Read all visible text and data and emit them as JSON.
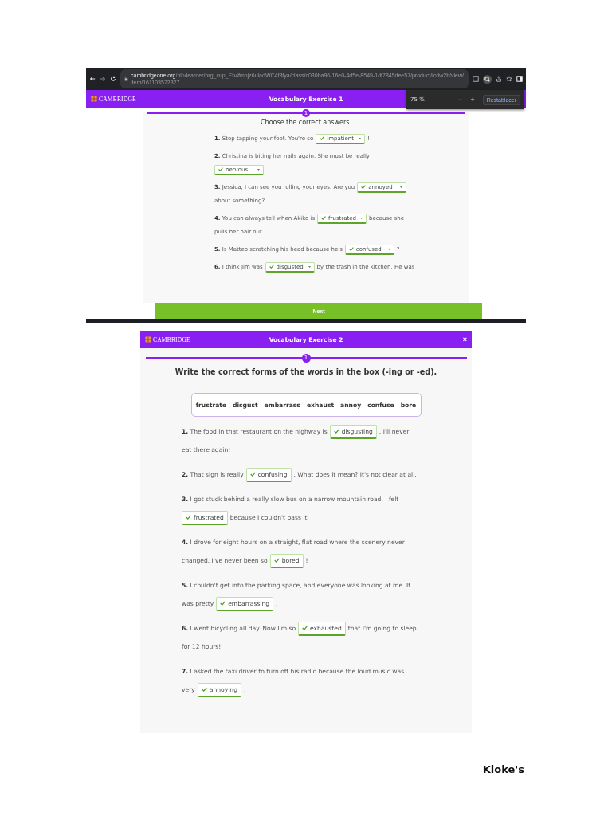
{
  "screenshots": [
    {
      "browser": {
        "url": "**cambridgeone.org**/nlp/learner/org_cup_Eb4fmnjz6uladWC4f3fya/class/c030ba96-16e0-4d5e-8549-1df7845dee57/product/icdw2b/view/item/161103572327..."
      },
      "zoom_popup": {
        "level": "75 %",
        "minus": "−",
        "plus": "+",
        "reset": "Restablecer"
      },
      "header": {
        "logo": "CAMBRIDGE",
        "title": "Vocabulary Exercise 1"
      },
      "progress": {
        "step": "1"
      },
      "instruction": "Choose the correct answers.",
      "items": [
        {
          "parts": [
            {
              "kind": "text",
              "text": "**1.** Stop tapping your foot. You're so"
            },
            {
              "kind": "answer",
              "text": "impatient",
              "correct": true
            },
            {
              "kind": "text",
              "text": "!"
            }
          ]
        },
        {
          "parts": [
            {
              "kind": "text",
              "text": "**2.** Christina is biting her nails again. She must be really"
            },
            {
              "kind": "answer",
              "text": "nervous",
              "correct": true
            },
            {
              "kind": "text",
              "text": "."
            }
          ]
        },
        {
          "parts": [
            {
              "kind": "text",
              "text": "**3.** Jessica, I can see you rolling your eyes. Are you"
            },
            {
              "kind": "answer",
              "text": "annoyed",
              "correct": true
            },
            {
              "kind": "text",
              "text": "about something?"
            }
          ]
        },
        {
          "parts": [
            {
              "kind": "text",
              "text": "**4.** You can always tell when Akiko is"
            },
            {
              "kind": "answer",
              "text": "frustrated",
              "correct": true
            },
            {
              "kind": "text",
              "text": "because she pulls her hair out."
            }
          ]
        },
        {
          "parts": [
            {
              "kind": "text",
              "text": "**5.** Is Matteo scratching his head because he's"
            },
            {
              "kind": "answer",
              "text": "confused",
              "correct": true
            },
            {
              "kind": "text",
              "text": "?"
            }
          ]
        },
        {
          "parts": [
            {
              "kind": "text",
              "text": "**6.** I think Jim was"
            },
            {
              "kind": "answer",
              "text": "disgusted",
              "correct": true
            },
            {
              "kind": "text",
              "text": "by the trash in the kitchen. He was"
            }
          ]
        }
      ],
      "next_button": "Next"
    },
    {
      "header": {
        "logo": "CAMBRIDGE",
        "title": "Vocabulary Exercise 2",
        "close": "×"
      },
      "progress": {
        "step": "1"
      },
      "instruction": "Write the correct forms of the words in the box (-ing or -ed).",
      "word_box": [
        "frustrate",
        "disgust",
        "embarrass",
        "exhaust",
        "annoy",
        "confuse",
        "bore"
      ],
      "items": [
        {
          "parts": [
            {
              "kind": "text",
              "text": "**1.** The food in that restaurant on the highway is"
            },
            {
              "kind": "answer",
              "text": "disgusting",
              "correct": true
            },
            {
              "kind": "text",
              "text": ". I'll never eat there again!"
            }
          ]
        },
        {
          "parts": [
            {
              "kind": "text",
              "text": "**2.** That sign is really"
            },
            {
              "kind": "answer",
              "text": "confusing",
              "correct": true
            },
            {
              "kind": "text",
              "text": ". What does it mean? It's not clear at all."
            }
          ]
        },
        {
          "parts": [
            {
              "kind": "text",
              "text": "**3.** I got stuck behind a really slow bus on a narrow mountain road. I felt"
            },
            {
              "kind": "answer",
              "text": "frustrated",
              "correct": true
            },
            {
              "kind": "text",
              "text": "because I couldn't pass it."
            }
          ]
        },
        {
          "parts": [
            {
              "kind": "text",
              "text": "**4.** I drove for eight hours on a straight, flat road where the scenery never changed. I've never been so"
            },
            {
              "kind": "answer",
              "text": "bored",
              "correct": true
            },
            {
              "kind": "text",
              "text": "!"
            }
          ]
        },
        {
          "parts": [
            {
              "kind": "text",
              "text": "**5.** I couldn't get into the parking space, and everyone was looking at me. It was pretty"
            },
            {
              "kind": "answer",
              "text": "embarrassing",
              "correct": true
            },
            {
              "kind": "text",
              "text": "."
            }
          ]
        },
        {
          "parts": [
            {
              "kind": "text",
              "text": "**6.** I went bicycling all day. Now I'm so"
            },
            {
              "kind": "answer",
              "text": "exhausted",
              "correct": true
            },
            {
              "kind": "text",
              "text": "that I'm going to sleep for 12 hours!"
            }
          ]
        },
        {
          "parts": [
            {
              "kind": "text",
              "text": "**7.** I asked the taxi driver to turn off his radio because the loud music was very"
            },
            {
              "kind": "answer",
              "text": "annoying",
              "correct": true
            },
            {
              "kind": "text",
              "text": "."
            }
          ]
        }
      ]
    }
  ],
  "footer_mark": "Kloke's"
}
